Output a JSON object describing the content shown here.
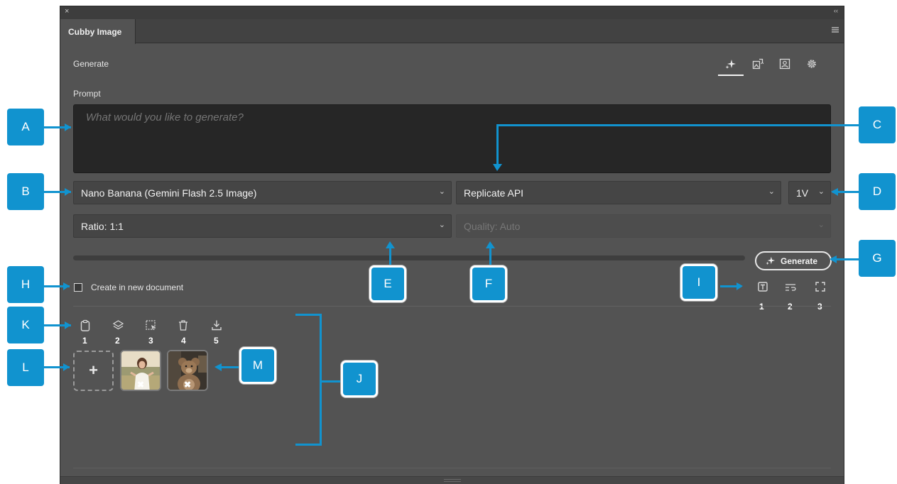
{
  "window": {
    "close_glyph": "×",
    "collapse_glyph": "‹‹"
  },
  "tab": {
    "title": "Cubby Image"
  },
  "header": {
    "section": "Generate",
    "nav_icons": [
      "generate-sparkle-icon",
      "image-swap-icon",
      "person-frame-icon",
      "settings-gear-icon"
    ]
  },
  "prompt": {
    "label": "Prompt",
    "placeholder": "What would you like to generate?"
  },
  "model_select": {
    "value": "Nano Banana (Gemini Flash 2.5 Image)"
  },
  "provider_select": {
    "value": "Replicate API"
  },
  "count_select": {
    "value": "1V"
  },
  "ratio_select": {
    "value": "Ratio: 1:1"
  },
  "quality_select": {
    "value": "Quality: Auto",
    "disabled": true
  },
  "generate_button": {
    "label": "Generate"
  },
  "new_document": {
    "label": "Create in new document",
    "checked": false
  },
  "output_icons": {
    "numbers": [
      "1",
      "2",
      "3"
    ],
    "icons": [
      "text-layer-icon",
      "wrap-lines-icon",
      "expand-frame-icon"
    ]
  },
  "reference_toolbar": {
    "numbers": [
      "1",
      "2",
      "3",
      "4",
      "5"
    ],
    "icons": [
      "clipboard-icon",
      "layers-icon",
      "selection-icon",
      "trash-icon",
      "download-icon"
    ]
  },
  "reference_images": {
    "add_glyph": "+",
    "remove_glyph": "✖",
    "thumbnails": [
      "woman-in-field-thumbnail",
      "teddy-bear-thumbnail"
    ]
  },
  "annotations": {
    "labels": [
      "A",
      "B",
      "C",
      "D",
      "E",
      "F",
      "G",
      "H",
      "I",
      "J",
      "K",
      "L",
      "M"
    ],
    "color": "#1193cf"
  },
  "colors": {
    "panel_bg": "#535353",
    "field_bg": "#262626",
    "select_bg": "#454545",
    "accent": "#1193cf"
  }
}
